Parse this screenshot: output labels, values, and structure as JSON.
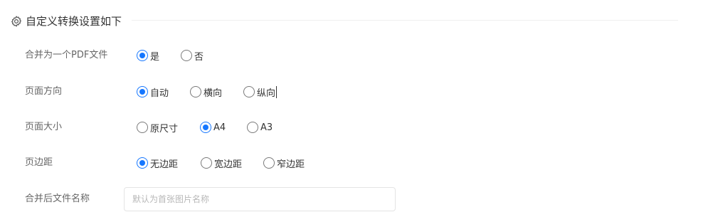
{
  "section": {
    "icon": "gear-icon",
    "title": "自定义转换设置如下"
  },
  "colors": {
    "accent": "#1677ff",
    "label": "#666666",
    "text": "#333333"
  },
  "rows": [
    {
      "label": "合并为一个PDF文件",
      "options": [
        {
          "label": "是",
          "checked": true
        },
        {
          "label": "否",
          "checked": false
        }
      ]
    },
    {
      "label": "页面方向",
      "options": [
        {
          "label": "自动",
          "checked": true
        },
        {
          "label": "横向",
          "checked": false
        },
        {
          "label": "纵向",
          "checked": false
        }
      ]
    },
    {
      "label": "页面大小",
      "options": [
        {
          "label": "原尺寸",
          "checked": false
        },
        {
          "label": "A4",
          "checked": true
        },
        {
          "label": "A3",
          "checked": false
        }
      ]
    },
    {
      "label": "页边距",
      "options": [
        {
          "label": "无边距",
          "checked": true
        },
        {
          "label": "宽边距",
          "checked": false
        },
        {
          "label": "窄边距",
          "checked": false
        }
      ]
    }
  ],
  "filename": {
    "label": "合并后文件名称",
    "value": "",
    "placeholder": "默认为首张图片名称"
  }
}
